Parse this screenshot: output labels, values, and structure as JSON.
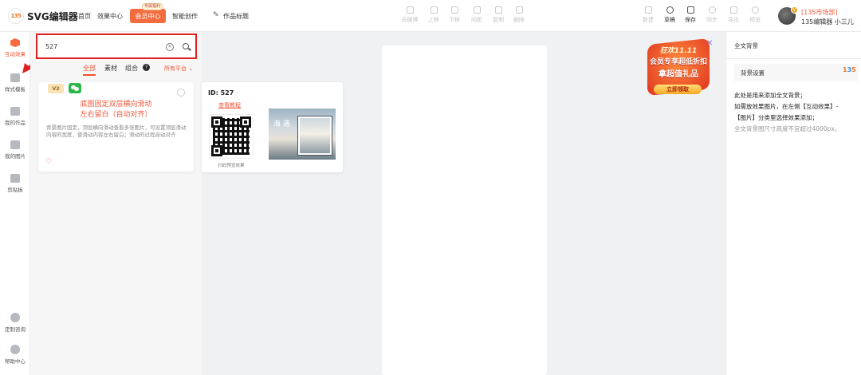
{
  "header": {
    "logo_text": "135",
    "app_title": "SVG编辑器",
    "nav": [
      "首页",
      "效果中心"
    ],
    "vip_label": "会员中心",
    "vip_tag": "专属福利",
    "smart_label": "智能创作",
    "work_title": "作品标题",
    "tools_center": [
      "去微博",
      "上移",
      "下移",
      "间距",
      "复制",
      "删除"
    ],
    "tools_right": [
      {
        "label": "新建",
        "active": false
      },
      {
        "label": "草稿",
        "active": true
      },
      {
        "label": "保存",
        "active": true
      },
      {
        "label": "同步",
        "active": false
      },
      {
        "label": "导出",
        "active": false
      },
      {
        "label": "预览",
        "active": false
      }
    ],
    "user_market": "[135市场部]",
    "user_name": "135编辑器 小三儿"
  },
  "rail": {
    "items": [
      "互动效果",
      "样式模板",
      "我的作品",
      "我的图片",
      "剪贴板"
    ],
    "bottom": [
      "定制咨询",
      "帮助中心"
    ]
  },
  "search": {
    "value": "527",
    "placeholder": ""
  },
  "filters": {
    "all": "全部",
    "material": "素材",
    "combo": "组合",
    "platform": "所有平台 ⌄"
  },
  "card": {
    "badge": "V2",
    "title_line1": "底图固定双层横向滑动",
    "title_line2": "左右留白（自动对齐）",
    "description": "背景图片固定，顶层横向滑动查看多张图片，可设置顶层滑动内容的宽度，使滑动内容左右留白；滑动的过程自动对齐"
  },
  "preview": {
    "id": "ID: 527",
    "link": "查看教程",
    "qr_caption": "扫码预览效果",
    "thumb_text": "海 遇"
  },
  "promo": {
    "line1": "狂欢11.11",
    "line2": "会员专享超低折扣",
    "line3": "拿超值礼品",
    "button": "立即领取"
  },
  "right_panel": {
    "title": "全文背景",
    "setting_label": "背景设置",
    "line1": "此处是用来添加全文背景；",
    "line2": "如需放效果图片，在左侧【互动效果】-",
    "line3": "【图片】分类里选择效果添加；",
    "note": "全文背景图尺寸高度不宜超过4000px。"
  }
}
